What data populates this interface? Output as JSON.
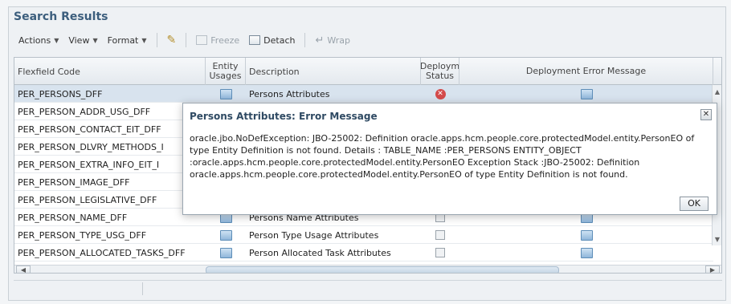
{
  "panel": {
    "title": "Search Results"
  },
  "toolbar": {
    "actions": "Actions",
    "view": "View",
    "format": "Format",
    "freeze": "Freeze",
    "detach": "Detach",
    "wrap": "Wrap"
  },
  "table": {
    "columns": {
      "code": "Flexfield Code",
      "usages": "Entity Usages",
      "description": "Description",
      "status": "Deploym Status",
      "error": "Deployment Error Message"
    },
    "rows": [
      {
        "code": "PER_PERSONS_DFF",
        "description": "Persons Attributes"
      },
      {
        "code": "PER_PERSON_ADDR_USG_DFF",
        "description": ""
      },
      {
        "code": "PER_PERSON_CONTACT_EIT_DFF",
        "description": ""
      },
      {
        "code": "PER_PERSON_DLVRY_METHODS_I",
        "description": ""
      },
      {
        "code": "PER_PERSON_EXTRA_INFO_EIT_I",
        "description": ""
      },
      {
        "code": "PER_PERSON_IMAGE_DFF",
        "description": ""
      },
      {
        "code": "PER_PERSON_LEGISLATIVE_DFF",
        "description": ""
      },
      {
        "code": "PER_PERSON_NAME_DFF",
        "description": "Persons Name Attributes"
      },
      {
        "code": "PER_PERSON_TYPE_USG_DFF",
        "description": "Person Type Usage Attributes"
      },
      {
        "code": "PER_PERSON_ALLOCATED_TASKS_DFF",
        "description": "Person Allocated Task Attributes"
      }
    ]
  },
  "dialog": {
    "title": "Persons Attributes: Error Message",
    "message": "oracle.jbo.NoDefException: JBO-25002: Definition oracle.apps.hcm.people.core.protectedModel.entity.PersonEO of type Entity Definition is not found. Details : TABLE_NAME :PER_PERSONS ENTITY_OBJECT :oracle.apps.hcm.people.core.protectedModel.entity.PersonEO Exception Stack :JBO-25002: Definition oracle.apps.hcm.people.core.protectedModel.entity.PersonEO of type Entity Definition is not found.",
    "ok": "OK"
  },
  "colors": {
    "title": "#3c5e7d",
    "selected_row": "#d8e3ee",
    "error": "#d44a4a"
  }
}
